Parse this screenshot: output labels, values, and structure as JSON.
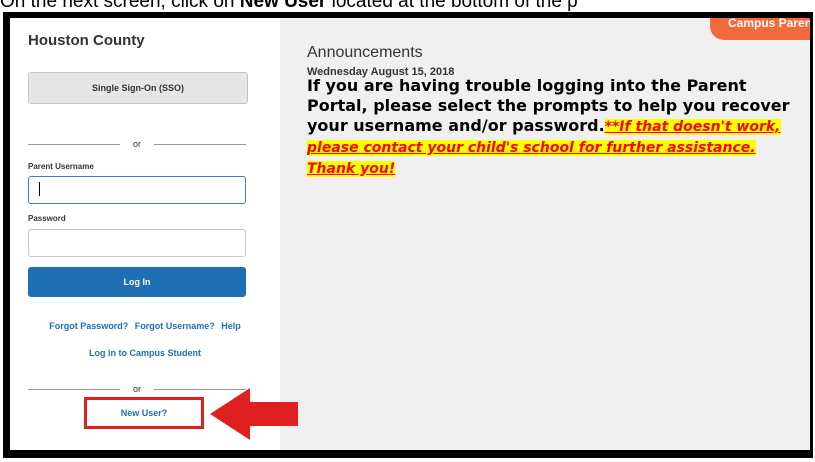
{
  "caption": {
    "text_before": "On the next screen, click on ",
    "bold_text": "New User",
    "text_after": " located at the bottom of the p"
  },
  "badge": {
    "label": "Campus Parent"
  },
  "login": {
    "district": "Houston County",
    "sso_label": "Single Sign-On (SSO)",
    "or_label": "or",
    "username_label": "Parent Username",
    "username_value": "",
    "password_label": "Password",
    "password_value": "",
    "login_label": "Log In",
    "forgot_password": "Forgot Password?",
    "forgot_username": "Forgot Username?",
    "help": "Help",
    "campus_student": "Log in to Campus Student",
    "or_label_2": "or",
    "new_user": "New User?"
  },
  "announcements": {
    "title": "Announcements",
    "date": "Wednesday August 15, 2018",
    "body": "If you are having trouble logging into the Parent Portal, please select the prompts to help you recover your username and/or password.",
    "highlight": "**If that doesn't work, please contact your child's school for further assistance. Thank you!"
  },
  "colors": {
    "accent": "#1f6fb5",
    "badge": "#f26a3b",
    "callout": "#e02020",
    "highlight_bg": "#ffff00",
    "highlight_text": "#ff0000"
  }
}
